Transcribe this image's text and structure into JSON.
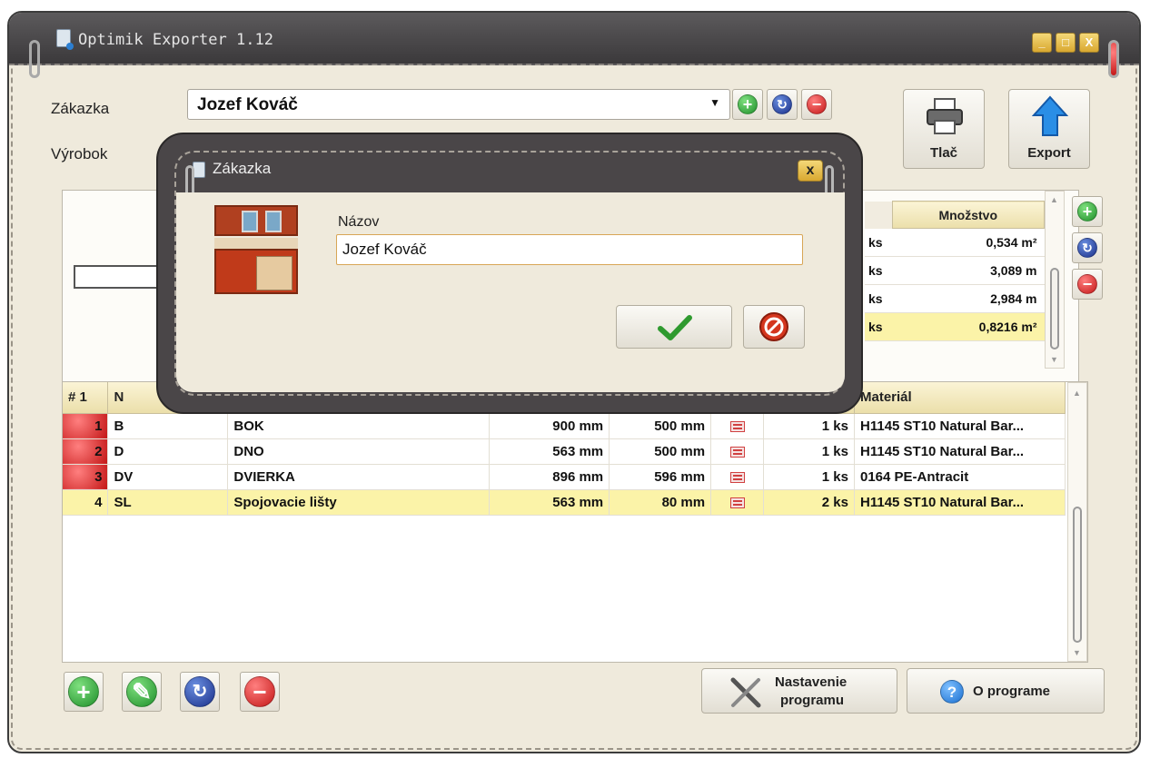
{
  "app": {
    "title": "Optimik Exporter 1.12",
    "window_controls": [
      "_",
      "□",
      "X"
    ]
  },
  "header": {
    "customer_label": "Zákazka",
    "customer_value": "Jozef Kováč",
    "product_label": "Výrobok",
    "print_label": "Tlač",
    "export_label": "Export"
  },
  "quantity_table": {
    "header": "Množstvo",
    "rows": [
      {
        "unit": "ks",
        "qty": "0,534 m²"
      },
      {
        "unit": "ks",
        "qty": "3,089 m"
      },
      {
        "unit": "ks",
        "qty": "2,984 m"
      },
      {
        "unit": "ks",
        "qty": "0,8216 m²"
      }
    ],
    "selected_row": 3
  },
  "parts_table": {
    "columns": [
      "# 1",
      "N",
      "",
      "",
      "",
      "",
      "",
      "Materiál"
    ],
    "rows": [
      {
        "num": "1",
        "code": "B",
        "name": "BOK",
        "length": "900 mm",
        "width": "500 mm",
        "count": "1 ks",
        "material": "H1145 ST10 Natural Bar..."
      },
      {
        "num": "2",
        "code": "D",
        "name": "DNO",
        "length": "563 mm",
        "width": "500 mm",
        "count": "1 ks",
        "material": "H1145 ST10 Natural Bar..."
      },
      {
        "num": "3",
        "code": "DV",
        "name": "DVIERKA",
        "length": "896 mm",
        "width": "596 mm",
        "count": "1 ks",
        "material": "0164 PE-Antracit"
      },
      {
        "num": "4",
        "code": "SL",
        "name": "Spojovacie lišty",
        "length": "563 mm",
        "width": "80 mm",
        "count": "2 ks",
        "material": "H1145 ST10 Natural Bar..."
      }
    ],
    "selected_row": 3
  },
  "footer": {
    "settings_label_line1": "Nastavenie",
    "settings_label_line2": "programu",
    "about_label": "O programe"
  },
  "dialog": {
    "title": "Zákazka",
    "close": "x",
    "name_label": "Názov",
    "name_value": "Jozef Kováč"
  },
  "colors": {
    "selection": "#fbf3a8",
    "window_bg": "#efeadc",
    "titlebar": "#4a484a",
    "add": "#1f8f2a",
    "edit": "#1a2f8a",
    "remove": "#c41717"
  },
  "icons": {
    "add": "plus-circle-icon",
    "refresh": "refresh-circle-icon",
    "remove": "minus-circle-icon",
    "print": "printer-icon",
    "export": "up-arrow-icon",
    "settings": "tools-icon",
    "help": "question-circle-icon",
    "ok": "checkmark-icon",
    "cancel": "no-entry-icon"
  }
}
